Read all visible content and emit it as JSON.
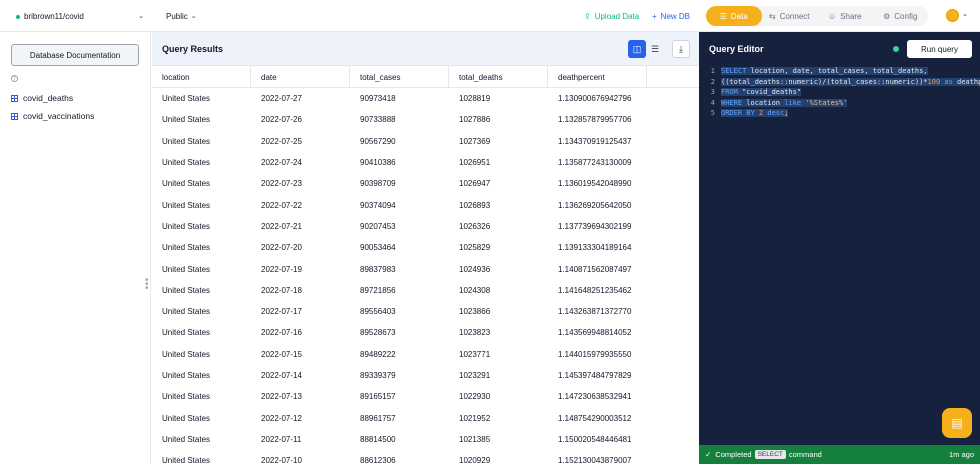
{
  "topbar": {
    "database": "bribrown11/covid",
    "schema": "Public",
    "upload_label": "Upload Data",
    "new_db_label": "New DB",
    "tabs": [
      {
        "label": "Data",
        "icon": "database-icon",
        "active": true
      },
      {
        "label": "Connect",
        "icon": "connect-icon",
        "active": false
      },
      {
        "label": "Share",
        "icon": "user-icon",
        "active": false
      },
      {
        "label": "Config",
        "icon": "gear-icon",
        "active": false
      }
    ]
  },
  "sidebar": {
    "doc_button": "Database Documentation",
    "help_icon": "?",
    "tables": [
      "covid_deaths",
      "covid_vaccinations"
    ]
  },
  "results": {
    "title": "Query Results",
    "columns": [
      "location",
      "date",
      "total_cases",
      "total_deaths",
      "deathpercent"
    ],
    "rows": [
      [
        "United States",
        "2022-07-27",
        "90973418",
        "1028819",
        "1.130900676942796"
      ],
      [
        "United States",
        "2022-07-26",
        "90733888",
        "1027886",
        "1.132857879957706"
      ],
      [
        "United States",
        "2022-07-25",
        "90567290",
        "1027369",
        "1.134370919125437"
      ],
      [
        "United States",
        "2022-07-24",
        "90410386",
        "1026951",
        "1.135877243130009"
      ],
      [
        "United States",
        "2022-07-23",
        "90398709",
        "1026947",
        "1.136019542048990"
      ],
      [
        "United States",
        "2022-07-22",
        "90374094",
        "1026893",
        "1.136269205642050"
      ],
      [
        "United States",
        "2022-07-21",
        "90207453",
        "1026326",
        "1.137739694302199"
      ],
      [
        "United States",
        "2022-07-20",
        "90053464",
        "1025829",
        "1.139133304189164"
      ],
      [
        "United States",
        "2022-07-19",
        "89837983",
        "1024936",
        "1.140871562087497"
      ],
      [
        "United States",
        "2022-07-18",
        "89721856",
        "1024308",
        "1.141648251235462"
      ],
      [
        "United States",
        "2022-07-17",
        "89556403",
        "1023866",
        "1.143263871372770"
      ],
      [
        "United States",
        "2022-07-16",
        "89528673",
        "1023823",
        "1.143569948814052"
      ],
      [
        "United States",
        "2022-07-15",
        "89489222",
        "1023771",
        "1.144015979935550"
      ],
      [
        "United States",
        "2022-07-14",
        "89339379",
        "1023291",
        "1.145397484797829"
      ],
      [
        "United States",
        "2022-07-13",
        "89165157",
        "1022930",
        "1.147230638532941"
      ],
      [
        "United States",
        "2022-07-12",
        "88961757",
        "1021952",
        "1.148754290003512"
      ],
      [
        "United States",
        "2022-07-11",
        "88814500",
        "1021385",
        "1.150020548446481"
      ],
      [
        "United States",
        "2022-07-10",
        "88612306",
        "1020929",
        "1.152130043879007"
      ]
    ]
  },
  "editor": {
    "title": "Query Editor",
    "run_label": "Run query",
    "lines": [
      {
        "n": "1",
        "parts": [
          [
            "kw",
            "SELECT"
          ],
          [
            "t",
            " location, date, total_cases, total_deaths,"
          ]
        ]
      },
      {
        "n": "2",
        "parts": [
          [
            "t",
            "((total_deaths::numeric)/(total_cases::numeric))*"
          ],
          [
            "num",
            "100"
          ],
          [
            "kw",
            " as"
          ],
          [
            "t",
            " deathpercent"
          ]
        ]
      },
      {
        "n": "3",
        "parts": [
          [
            "kw",
            "FROM"
          ],
          [
            "t",
            " \"covid_deaths\""
          ]
        ]
      },
      {
        "n": "4",
        "parts": [
          [
            "kw",
            "WHERE"
          ],
          [
            "t",
            " location "
          ],
          [
            "kw",
            "like"
          ],
          [
            "str",
            " '%States%'"
          ]
        ]
      },
      {
        "n": "5",
        "parts": [
          [
            "kw",
            "ORDER BY"
          ],
          [
            "num",
            " 2"
          ],
          [
            "kw",
            " desc"
          ],
          [
            "t",
            ";"
          ]
        ]
      }
    ]
  },
  "footer": {
    "status": "Completed",
    "command_pill": "SELECT",
    "command_label": "command",
    "time_ago": "1m ago"
  }
}
